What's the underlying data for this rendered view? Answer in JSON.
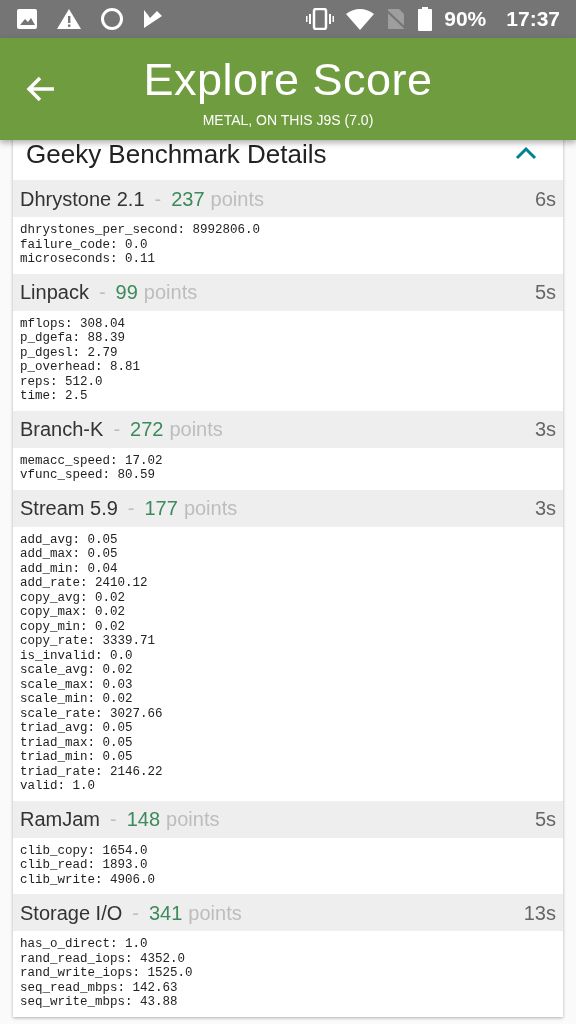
{
  "status_bar": {
    "battery": "90%",
    "time": "17:37"
  },
  "app_bar": {
    "title": "Explore Score",
    "subtitle": "METAL, ON THIS J9S (7.0)"
  },
  "card": {
    "title": "Geeky Benchmark Details",
    "expanded": true,
    "sections": [
      {
        "name": "Dhrystone 2.1",
        "separator": "-",
        "score": "237",
        "unit": "points",
        "time": "6s",
        "details": [
          "dhrystones_per_second: 8992806.0",
          "failure_code: 0.0",
          "microseconds: 0.11"
        ]
      },
      {
        "name": "Linpack",
        "separator": "-",
        "score": "99",
        "unit": "points",
        "time": "5s",
        "details": [
          "mflops: 308.04",
          "p_dgefa: 88.39",
          "p_dgesl: 2.79",
          "p_overhead: 8.81",
          "reps: 512.0",
          "time: 2.5"
        ]
      },
      {
        "name": "Branch-K",
        "separator": "-",
        "score": "272",
        "unit": "points",
        "time": "3s",
        "details": [
          "memacc_speed: 17.02",
          "vfunc_speed: 80.59"
        ]
      },
      {
        "name": "Stream 5.9",
        "separator": "-",
        "score": "177",
        "unit": "points",
        "time": "3s",
        "details": [
          "add_avg: 0.05",
          "add_max: 0.05",
          "add_min: 0.04",
          "add_rate: 2410.12",
          "copy_avg: 0.02",
          "copy_max: 0.02",
          "copy_min: 0.02",
          "copy_rate: 3339.71",
          "is_invalid: 0.0",
          "scale_avg: 0.02",
          "scale_max: 0.03",
          "scale_min: 0.02",
          "scale_rate: 3027.66",
          "triad_avg: 0.05",
          "triad_max: 0.05",
          "triad_min: 0.05",
          "triad_rate: 2146.22",
          "valid: 1.0"
        ]
      },
      {
        "name": "RamJam",
        "separator": "-",
        "score": "148",
        "unit": "points",
        "time": "5s",
        "details": [
          "clib_copy: 1654.0",
          "clib_read: 1893.0",
          "clib_write: 4906.0"
        ]
      },
      {
        "name": "Storage I/O",
        "separator": "-",
        "score": "341",
        "unit": "points",
        "time": "13s",
        "details": [
          "has_o_direct: 1.0",
          "rand_read_iops: 4352.0",
          "rand_write_iops: 1525.0",
          "seq_read_mbps: 142.63",
          "seq_write_mbps: 43.88"
        ]
      }
    ]
  }
}
